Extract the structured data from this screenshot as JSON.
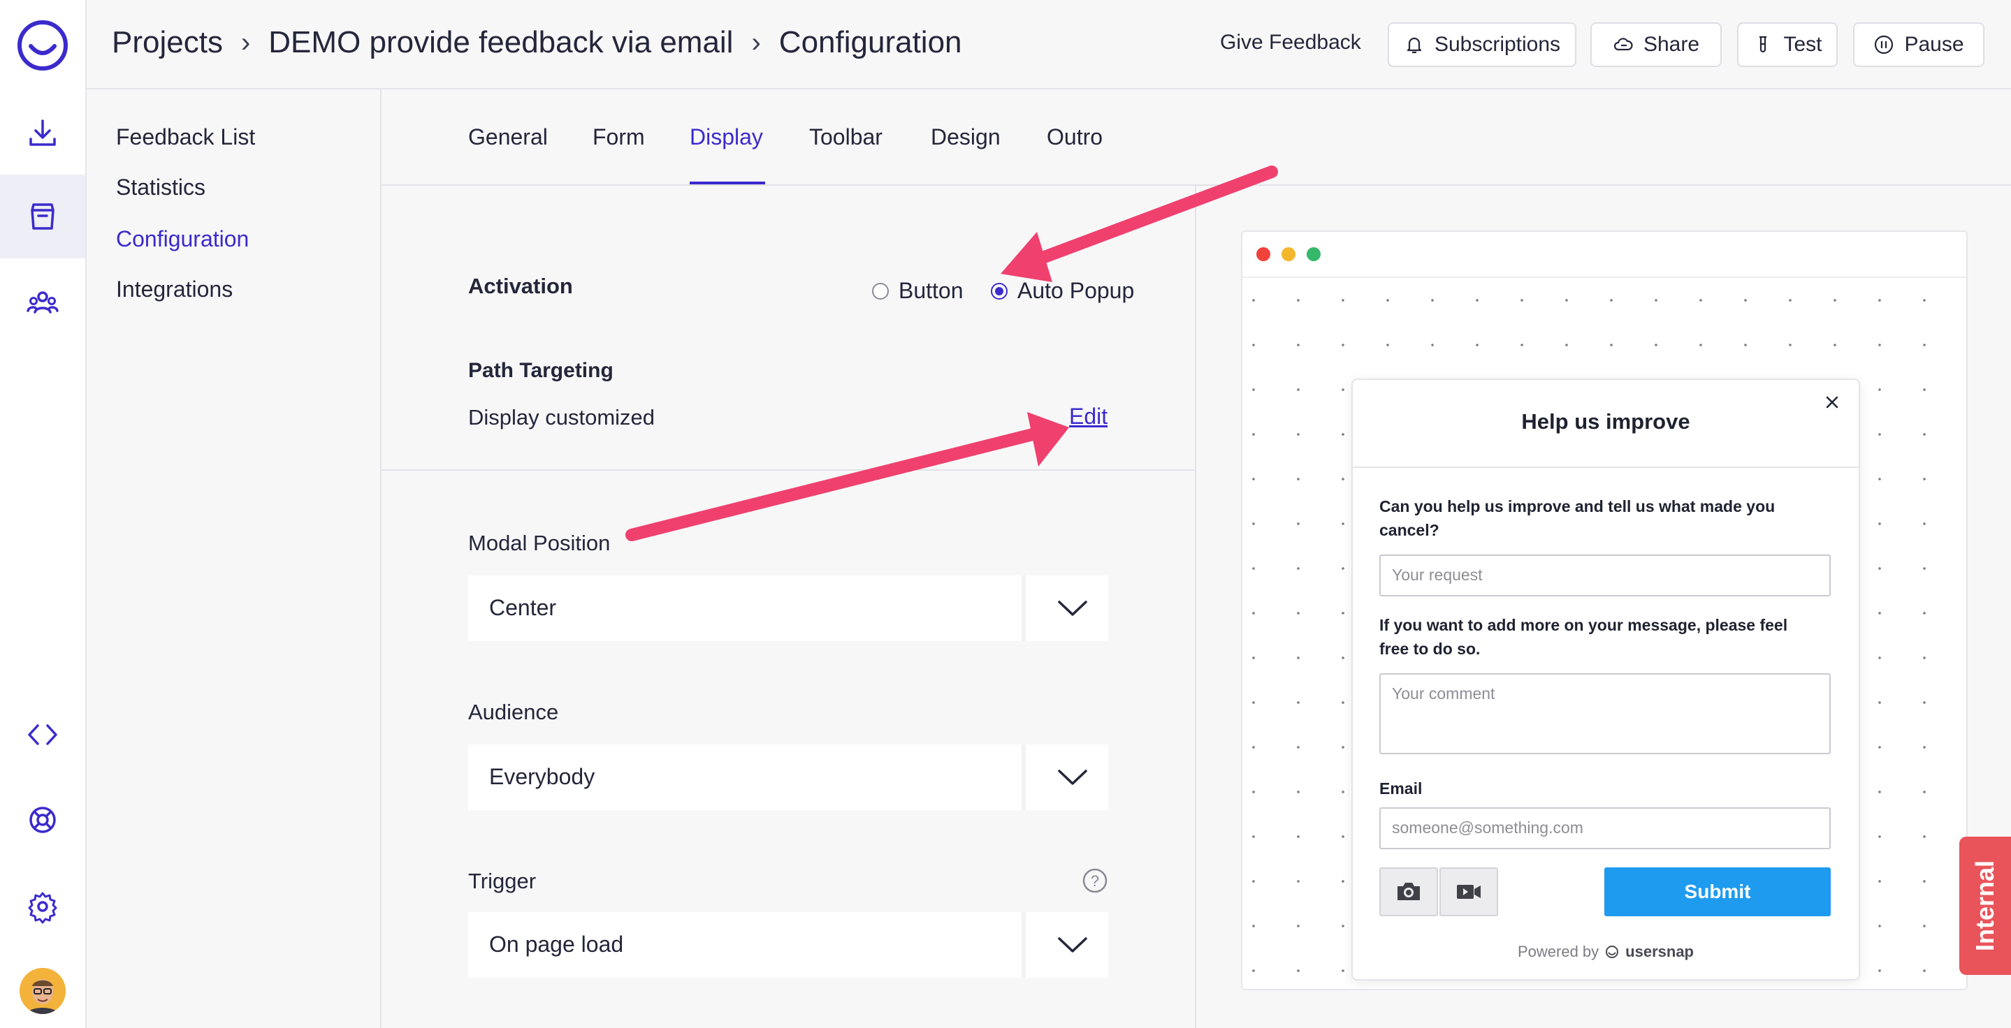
{
  "header": {
    "breadcrumb": [
      "Projects",
      "DEMO provide feedback via email",
      "Configuration"
    ],
    "give_feedback": "Give Feedback",
    "buttons": {
      "subscriptions": "Subscriptions",
      "share": "Share",
      "test": "Test",
      "pause": "Pause"
    }
  },
  "rail": {
    "icons": [
      "usersnap-logo-icon",
      "download-icon",
      "inbox-icon",
      "team-icon",
      "code-icon",
      "help-lifebuoy-icon",
      "settings-gear-icon",
      "avatar"
    ]
  },
  "subnav": {
    "items": [
      "Feedback List",
      "Statistics",
      "Configuration",
      "Integrations"
    ],
    "active": "Configuration"
  },
  "tabs": {
    "items": [
      "General",
      "Form",
      "Display",
      "Toolbar",
      "Design",
      "Outro"
    ],
    "active": "Display"
  },
  "settings": {
    "activation": {
      "label": "Activation",
      "options": [
        "Button",
        "Auto Popup"
      ],
      "selected": "Auto Popup"
    },
    "path_targeting": {
      "label": "Path Targeting",
      "value": "Display customized",
      "edit": "Edit"
    },
    "modal_position": {
      "label": "Modal Position",
      "value": "Center"
    },
    "audience": {
      "label": "Audience",
      "value": "Everybody"
    },
    "trigger": {
      "label": "Trigger",
      "value": "On page load"
    }
  },
  "preview": {
    "modal": {
      "title": "Help us improve",
      "q1": "Can you help us improve and tell us what made you cancel?",
      "q1_placeholder": "Your request",
      "q2": "If you want to add more on your message, please feel free to do so.",
      "q2_placeholder": "Your comment",
      "email_label": "Email",
      "email_placeholder": "someone@something.com",
      "submit": "Submit",
      "powered_by": "Powered by",
      "brand": "usersnap"
    }
  },
  "internal_tab": "Internal",
  "colors": {
    "accent": "#3b2bcc",
    "submit": "#1e9bef",
    "annotation_arrow": "#f0406e",
    "internal": "#e9545a"
  }
}
